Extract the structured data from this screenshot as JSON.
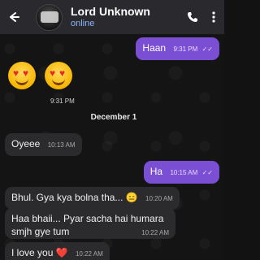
{
  "header": {
    "contact_name": "Lord Unknown",
    "contact_status": "online",
    "icons": {
      "back": "arrow-left",
      "call": "phone",
      "menu": "more-vertical"
    }
  },
  "messages": [
    {
      "id": "m1",
      "direction": "out",
      "text": "Haan",
      "time": "9:31 PM",
      "ticks": "✓✓"
    },
    {
      "id": "m2",
      "direction": "out-emoji",
      "text": "😍😍",
      "time": "9:31 PM"
    },
    {
      "id": "sep",
      "direction": "separator",
      "text": "December 1"
    },
    {
      "id": "m3",
      "direction": "in",
      "text": "Oyeee",
      "time": "10:13 AM"
    },
    {
      "id": "m4",
      "direction": "out",
      "text": "Ha",
      "time": "10:15 AM",
      "ticks": "✓✓"
    },
    {
      "id": "m5",
      "direction": "in",
      "text": "Bhul. Gya kya bolna tha... 😑",
      "time": "10:20 AM"
    },
    {
      "id": "m6",
      "direction": "in",
      "text_line1": "Haa bhaii... Pyar sacha hai humara",
      "text_line2": "smjh gye tum",
      "time": "10:22 AM"
    },
    {
      "id": "m7",
      "direction": "in",
      "text": "I love you ❤️",
      "time": "10:22 AM"
    }
  ],
  "colors": {
    "header_bg": "#2a2a2e",
    "incoming_bubble": "#2b2b2e",
    "outgoing_bubble": "#7b4fd3",
    "status_online": "#8ab4f8",
    "chat_bg": "#141414"
  }
}
